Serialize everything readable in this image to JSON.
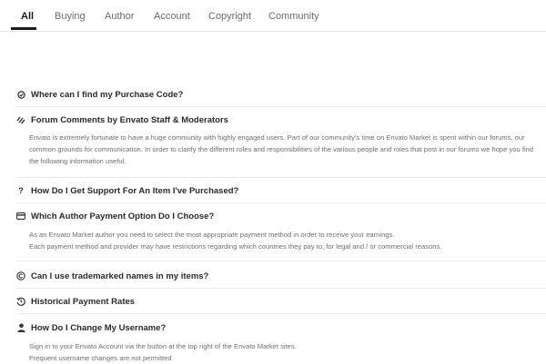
{
  "tabs": [
    {
      "label": "All"
    },
    {
      "label": "Buying"
    },
    {
      "label": "Author"
    },
    {
      "label": "Account"
    },
    {
      "label": "Copyright"
    },
    {
      "label": "Community"
    }
  ],
  "faq": [
    {
      "question": "Where can I find my Purchase Code?",
      "icon": "check-circle-icon",
      "answer": []
    },
    {
      "question": "Forum Comments by Envato Staff & Moderators",
      "icon": "comments-icon",
      "answer": [
        "Envato is extremely fortunate to have a huge community with highly engaged users. Part of our community's time on Envato Market is spent within our forums, our common grounds for communication. In order to clarify the different roles and responsibilities of the various people and roles that post in our forums we hope you find the following information useful."
      ]
    },
    {
      "question": "How Do I Get Support For An Item I've Purchased?",
      "icon": "question-icon",
      "answer": []
    },
    {
      "question": "Which Author Payment Option Do I Choose?",
      "icon": "credit-card-icon",
      "answer": [
        "As an Envato Market author you need to select the most appropriate payment method in order to receive your earnings.",
        "Each payment method and provider may have restrictions regarding which countries they pay to, for legal and / or commercial reasons."
      ]
    },
    {
      "question": "Can I use trademarked names in my items?",
      "icon": "copyright-icon",
      "answer": []
    },
    {
      "question": "Historical Payment Rates",
      "icon": "history-icon",
      "answer": []
    },
    {
      "question": "How Do I Change My Username?",
      "icon": "user-icon",
      "answer": [
        "Sign in to your Envato Account via the button at the top right of the Envato Market sites.",
        "Frequent username changes are not permitted"
      ]
    }
  ]
}
